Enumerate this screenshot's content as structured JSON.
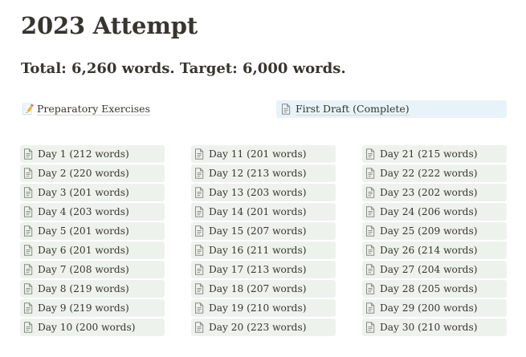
{
  "page": {
    "title": "2023 Attempt",
    "subtitle": "Total: 6,260 words. Target: 6,000 words."
  },
  "links": {
    "preparatory": {
      "label": "Preparatory Exercises",
      "icon": "pencil-memo-icon"
    },
    "first_draft": {
      "label": "First Draft (Complete)",
      "icon": "document-icon",
      "background": "#e7f3f8"
    }
  },
  "days": {
    "item_background": "#edf3ec",
    "icon": "document-icon",
    "columns": [
      [
        "Day 1 (212 words)",
        "Day 2 (220 words)",
        "Day 3 (201 words)",
        "Day 4 (203 words)",
        "Day 5 (201 words)",
        "Day 6 (201 words)",
        "Day 7 (208 words)",
        "Day 8 (219 words)",
        "Day 9 (219 words)",
        "Day 10 (200 words)"
      ],
      [
        "Day 11 (201 words)",
        "Day 12 (213 words)",
        "Day 13 (203 words)",
        "Day 14 (201 words)",
        "Day 15 (207 words)",
        "Day 16 (211 words)",
        "Day 17 (213 words)",
        "Day 18 (207 words)",
        "Day 19 (210 words)",
        "Day 20 (223 words)"
      ],
      [
        "Day 21 (215 words)",
        "Day 22 (222 words)",
        "Day 23 (202 words)",
        "Day 24 (206 words)",
        "Day 25 (209 words)",
        "Day 26 (214 words)",
        "Day 27 (204 words)",
        "Day 28 (205 words)",
        "Day 29 (200 words)",
        "Day 30 (210 words)"
      ]
    ]
  }
}
